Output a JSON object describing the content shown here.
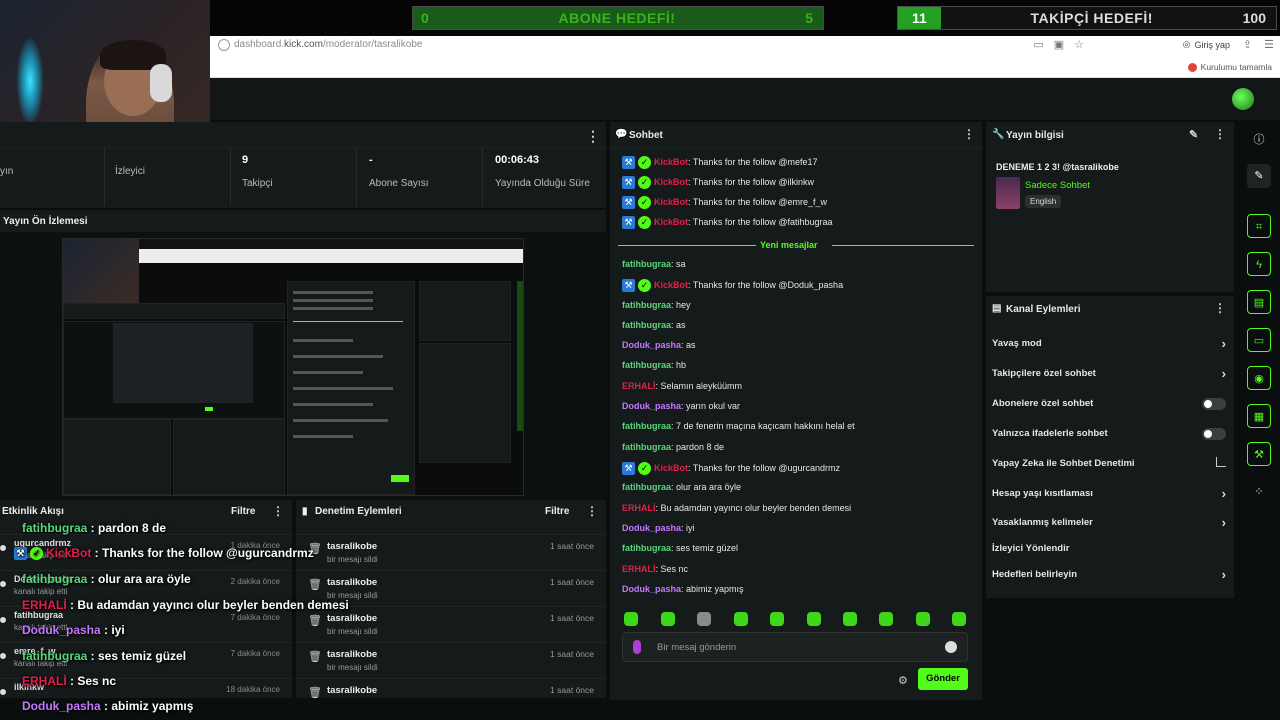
{
  "goals": {
    "sub": {
      "current": "0",
      "title": "ABONE HEDEFİ!",
      "target": "5"
    },
    "follow": {
      "current": "11",
      "title": "TAKİPÇİ HEDEFİ!",
      "target": "100"
    }
  },
  "browser": {
    "url_prefix": "dashboard.",
    "url_domain": "kick.com",
    "url_path": "/moderator/tasralikobe",
    "login_label": "Giriş yap",
    "setup_label": "Kurulumu tamamla"
  },
  "stats": [
    {
      "value": "",
      "label": "yın"
    },
    {
      "value": "",
      "label": "İzleyici"
    },
    {
      "value": "9",
      "label": "Takipçi"
    },
    {
      "value": "-",
      "label": "Abone Sayısı"
    },
    {
      "value": "00:06:43",
      "label": "Yayında Olduğu Süre"
    }
  ],
  "preview": {
    "title": "Yayın Ön İzlemesi"
  },
  "activity": {
    "title": "Etkinlik Akışı",
    "filter": "Filtre",
    "rows": [
      {
        "name": "ugurcandrmz",
        "sub": "kanalı takip etti",
        "time": "1 dakika önce"
      },
      {
        "name": "Doduk_pasha",
        "sub": "kanalı takip etti",
        "time": "2 dakika önce"
      },
      {
        "name": "fatihbugraa",
        "sub": "kanalı takip etti",
        "time": "7 dakika önce"
      },
      {
        "name": "emre_f_w",
        "sub": "kanalı takip etti",
        "time": "7 dakika önce"
      },
      {
        "name": "ilkinkw",
        "sub": "",
        "time": "18 dakika önce"
      }
    ]
  },
  "moderation": {
    "title": "Denetim Eylemleri",
    "filter": "Filtre",
    "rows": [
      {
        "name": "tasralikobe",
        "sub": "bir mesajı sildi",
        "time": "1 saat önce"
      },
      {
        "name": "tasralikobe",
        "sub": "bir mesajı sildi",
        "time": "1 saat önce"
      },
      {
        "name": "tasralikobe",
        "sub": "bir mesajı sildi",
        "time": "1 saat önce"
      },
      {
        "name": "tasralikobe",
        "sub": "bir mesajı sildi",
        "time": "1 saat önce"
      },
      {
        "name": "tasralikobe",
        "sub": "",
        "time": "1 saat önce"
      }
    ]
  },
  "overlay": [
    {
      "user": "fatihbugraa",
      "msg": " : pardon 8 de",
      "color": "#5ad67a"
    },
    {
      "user": "KickBot",
      "msg": " : Thanks for the follow @ugurcandrmz",
      "color": "#e0204a"
    },
    {
      "user": "fatihbugraa",
      "msg": " : olur ara ara öyle",
      "color": "#5ad67a"
    },
    {
      "user": "ERHALİ",
      "msg": " : Bu adamdan yayıncı olur beyler benden demesi",
      "color": "#e0204a"
    },
    {
      "user": "Doduk_pasha",
      "msg": " : iyi",
      "color": "#c477ff"
    },
    {
      "user": "fatihbugraa",
      "msg": " : ses temiz güzel",
      "color": "#5ad67a"
    },
    {
      "user": "ERHALİ",
      "msg": " : Ses nc",
      "color": "#e0204a"
    },
    {
      "user": "Doduk_pasha",
      "msg": " : abimiz yapmış",
      "color": "#c477ff"
    }
  ],
  "chat": {
    "title": "Sohbet",
    "new_messages": "Yeni mesajlar",
    "messages": [
      {
        "user": "KickBot",
        "text": ": Thanks for the follow @mefe17",
        "color": "#e0204a",
        "badges": true
      },
      {
        "user": "KickBot",
        "text": ": Thanks for the follow @ilkinkw",
        "color": "#e0204a",
        "badges": true
      },
      {
        "user": "KickBot",
        "text": ": Thanks for the follow @emre_f_w",
        "color": "#e0204a",
        "badges": true
      },
      {
        "user": "KickBot",
        "text": ": Thanks for the follow @fatihbugraa",
        "color": "#e0204a",
        "badges": true
      },
      {
        "user": "fatihbugraa",
        "text": ": sa",
        "color": "#5ad67a",
        "badges": false
      },
      {
        "user": "KickBot",
        "text": ": Thanks for the follow @Doduk_pasha",
        "color": "#e0204a",
        "badges": true
      },
      {
        "user": "fatihbugraa",
        "text": ": hey",
        "color": "#5ad67a",
        "badges": false
      },
      {
        "user": "fatihbugraa",
        "text": ": as",
        "color": "#5ad67a",
        "badges": false
      },
      {
        "user": "Doduk_pasha",
        "text": ": as",
        "color": "#c477ff",
        "badges": false
      },
      {
        "user": "fatihbugraa",
        "text": ": hb",
        "color": "#5ad67a",
        "badges": false
      },
      {
        "user": "ERHALİ",
        "text": ": Selamın aleyküümm",
        "color": "#e0204a",
        "badges": false
      },
      {
        "user": "Doduk_pasha",
        "text": ": yarın okul var",
        "color": "#c477ff",
        "badges": false
      },
      {
        "user": "fatihbugraa",
        "text": ": 7 de fenerin maçına kaçıcam hakkını helal et",
        "color": "#5ad67a",
        "badges": false
      },
      {
        "user": "fatihbugraa",
        "text": ": pardon 8 de",
        "color": "#5ad67a",
        "badges": false
      },
      {
        "user": "KickBot",
        "text": ": Thanks for the follow @ugurcandrmz",
        "color": "#e0204a",
        "badges": true
      },
      {
        "user": "fatihbugraa",
        "text": ": olur ara ara öyle",
        "color": "#5ad67a",
        "badges": false
      },
      {
        "user": "ERHALİ",
        "text": ": Bu adamdan yayıncı olur beyler benden demesi",
        "color": "#e0204a",
        "badges": false
      },
      {
        "user": "Doduk_pasha",
        "text": ": iyi",
        "color": "#c477ff",
        "badges": false
      },
      {
        "user": "fatihbugraa",
        "text": ": ses temiz güzel",
        "color": "#5ad67a",
        "badges": false
      },
      {
        "user": "ERHALİ",
        "text": ": Ses nc",
        "color": "#e0204a",
        "badges": false
      },
      {
        "user": "Doduk_pasha",
        "text": ": abimiz yapmış",
        "color": "#c477ff",
        "badges": false
      }
    ],
    "input_placeholder": "Bir mesaj gönderin",
    "send_label": "Gönder"
  },
  "stream_info": {
    "title": "Yayın bilgisi",
    "stream_title": "DENEME 1 2 3! @tasralikobe",
    "category": "Sadece Sohbet",
    "language": "English"
  },
  "channel_actions": {
    "title": "Kanal Eylemleri",
    "items": [
      {
        "label": "Yavaş mod",
        "control": "chevron"
      },
      {
        "label": "Takipçilere özel sohbet",
        "control": "chevron"
      },
      {
        "label": "Abonelere özel sohbet",
        "control": "toggle"
      },
      {
        "label": "Yalnızca ifadelerle sohbet",
        "control": "toggle"
      },
      {
        "label": "Yapay Zeka ile Sohbet Denetimi",
        "control": "external"
      },
      {
        "label": "Hesap yaşı kısıtlaması",
        "control": "chevron"
      },
      {
        "label": "Yasaklanmış kelimeler",
        "control": "chevron"
      },
      {
        "label": "İzleyici Yönlendir",
        "control": "none"
      },
      {
        "label": "Hedefleri belirleyin",
        "control": "chevron"
      }
    ]
  },
  "colors": {
    "accent": "#53fc18",
    "panel": "#151a1b",
    "background": "#0b0e0f"
  }
}
